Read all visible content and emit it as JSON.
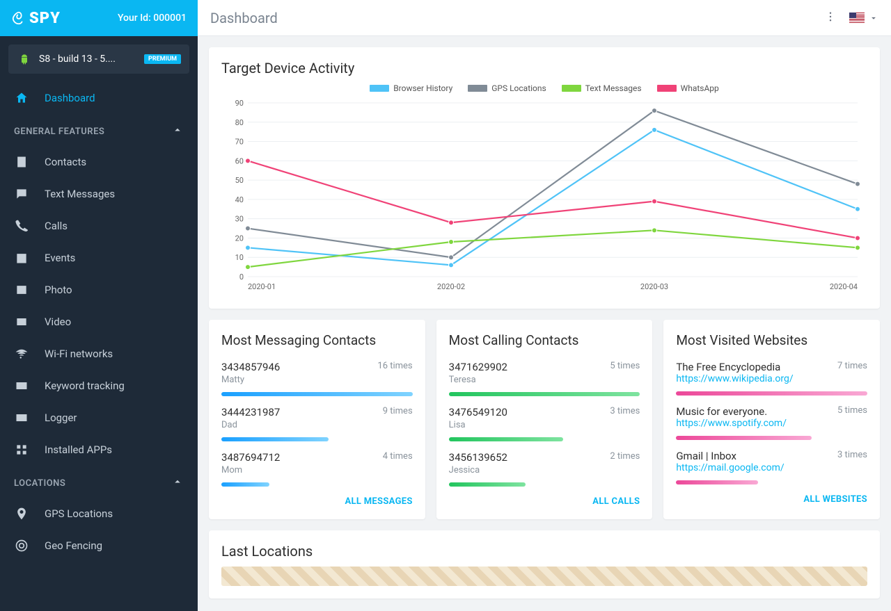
{
  "brand": "SPY",
  "your_id_label": "Your Id: 000001",
  "device": {
    "name": "S8 - build 13 - 5....",
    "badge": "PREMIUM"
  },
  "page_title": "Dashboard",
  "nav_active": "Dashboard",
  "nav": {
    "general_header": "GENERAL FEATURES",
    "locations_header": "LOCATIONS",
    "general": [
      "Contacts",
      "Text Messages",
      "Calls",
      "Events",
      "Photo",
      "Video",
      "Wi-Fi networks",
      "Keyword tracking",
      "Logger",
      "Installed APPs"
    ],
    "locations": [
      "GPS Locations",
      "Geo Fencing"
    ]
  },
  "chart_data": {
    "type": "line",
    "title": "Target Device Activity",
    "x": [
      "2020-01",
      "2020-02",
      "2020-03",
      "2020-04"
    ],
    "y_ticks": [
      0,
      10,
      20,
      30,
      40,
      50,
      60,
      70,
      80,
      90
    ],
    "ylim": [
      0,
      90
    ],
    "series": [
      {
        "name": "Browser History",
        "color": "#4fc3f7",
        "values": [
          15,
          6,
          76,
          35
        ]
      },
      {
        "name": "GPS Locations",
        "color": "#808b96",
        "values": [
          25,
          10,
          86,
          48
        ]
      },
      {
        "name": "Text Messages",
        "color": "#7fd63e",
        "values": [
          5,
          18,
          24,
          15
        ]
      },
      {
        "name": "WhatsApp",
        "color": "#f04277",
        "values": [
          60,
          28,
          39,
          20
        ]
      }
    ]
  },
  "panels": {
    "messaging": {
      "title": "Most Messaging Contacts",
      "items": [
        {
          "id": "3434857946",
          "name": "Matty",
          "count": "16 times",
          "pct": 100
        },
        {
          "id": "3444231987",
          "name": "Dad",
          "count": "9 times",
          "pct": 56
        },
        {
          "id": "3487694712",
          "name": "Mom",
          "count": "4 times",
          "pct": 25
        }
      ],
      "footer": "ALL MESSAGES",
      "bar_class": "bar-blue"
    },
    "calling": {
      "title": "Most Calling Contacts",
      "items": [
        {
          "id": "3471629902",
          "name": "Teresa",
          "count": "5 times",
          "pct": 100
        },
        {
          "id": "3476549120",
          "name": "Lisa",
          "count": "3 times",
          "pct": 60
        },
        {
          "id": "3456139652",
          "name": "Jessica",
          "count": "2 times",
          "pct": 40
        }
      ],
      "footer": "ALL CALLS",
      "bar_class": "bar-green"
    },
    "websites": {
      "title": "Most Visited Websites",
      "items": [
        {
          "id": "The Free Encyclopedia",
          "link": "https://www.wikipedia.org/",
          "count": "7 times",
          "pct": 100
        },
        {
          "id": "Music for everyone.",
          "link": "https://www.spotify.com/",
          "count": "5 times",
          "pct": 71
        },
        {
          "id": "Gmail | Inbox",
          "link": "https://mail.google.com/",
          "count": "3 times",
          "pct": 43
        }
      ],
      "footer": "ALL WEBSITES",
      "bar_class": "bar-pink"
    }
  },
  "last_locations_title": "Last Locations"
}
